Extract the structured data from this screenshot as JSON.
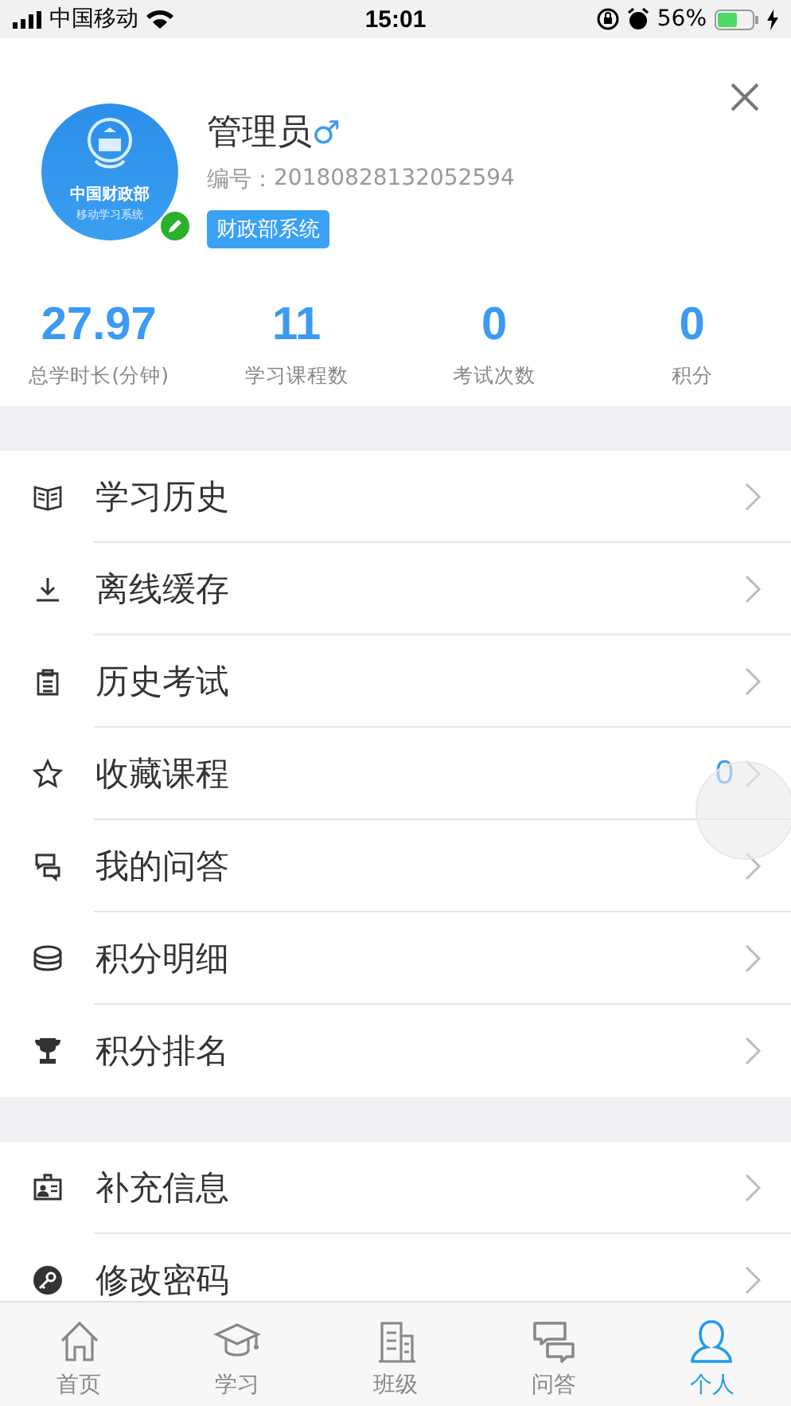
{
  "status_bar": {
    "carrier": "中国移动",
    "time": "15:01",
    "battery": "56%"
  },
  "profile": {
    "avatar_title": "中国财政部",
    "avatar_subtitle": "移动学习系统",
    "name": "管理员",
    "gender": "♂",
    "id_label": "编号：",
    "id": "20180828132052594",
    "tag": "财政部系统"
  },
  "stats": [
    {
      "value": "27.97",
      "label": "总学时长(分钟)"
    },
    {
      "value": "11",
      "label": "学习课程数"
    },
    {
      "value": "0",
      "label": "考试次数"
    },
    {
      "value": "0",
      "label": "积分"
    }
  ],
  "menu_groups": [
    [
      {
        "kind": "book",
        "label": "学习历史"
      },
      {
        "kind": "download",
        "label": "离线缓存"
      },
      {
        "kind": "clipboard",
        "label": "历史考试"
      },
      {
        "kind": "star",
        "label": "收藏课程",
        "count": "0"
      },
      {
        "kind": "chat",
        "label": "我的问答"
      },
      {
        "kind": "coins",
        "label": "积分明细"
      },
      {
        "kind": "trophy",
        "label": "积分排名"
      }
    ],
    [
      {
        "kind": "idcard",
        "label": "补充信息"
      },
      {
        "kind": "key",
        "label": "修改密码"
      }
    ]
  ],
  "tabs": [
    {
      "kind": "home",
      "label": "首页",
      "selected": false
    },
    {
      "kind": "cap",
      "label": "学习",
      "selected": false
    },
    {
      "kind": "building",
      "label": "班级",
      "selected": false
    },
    {
      "kind": "chat",
      "label": "问答",
      "selected": false
    },
    {
      "kind": "person",
      "label": "个人",
      "selected": true
    }
  ]
}
